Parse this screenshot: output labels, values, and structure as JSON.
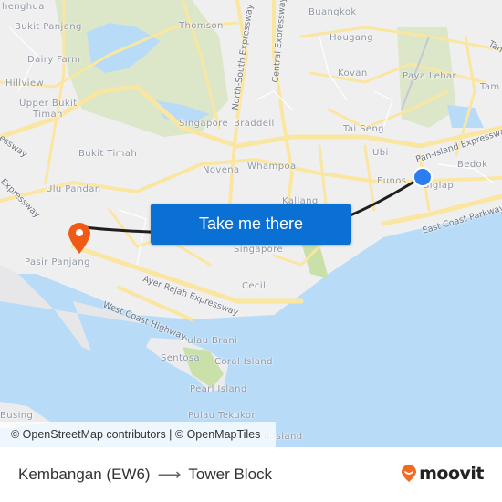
{
  "map": {
    "places": [
      {
        "name": "Chenghua",
        "text": "henghua"
      },
      {
        "name": "Bukit Panjang",
        "text": "Bukit Panjang"
      },
      {
        "name": "Dairy Farm",
        "text": "Dairy Farm"
      },
      {
        "name": "Hillview",
        "text": "Hillview"
      },
      {
        "name": "Upper Bukit Timah 1",
        "text": "Upper Bukit"
      },
      {
        "name": "Upper Bukit Timah 2",
        "text": "Timah"
      },
      {
        "name": "Thomson",
        "text": "Thomson"
      },
      {
        "name": "Buangkok",
        "text": "Buangkok"
      },
      {
        "name": "Hougang",
        "text": "Hougang"
      },
      {
        "name": "Kovan",
        "text": "Kovan"
      },
      {
        "name": "Paya Lebar",
        "text": "Paya Lebar"
      },
      {
        "name": "Tampines",
        "text": "Tam"
      },
      {
        "name": "Singapore Botanic",
        "text": "Singapore"
      },
      {
        "name": "Braddell",
        "text": "Braddell"
      },
      {
        "name": "Tai Seng",
        "text": "Tai Seng"
      },
      {
        "name": "Bukit Timah",
        "text": "Bukit Timah"
      },
      {
        "name": "Novena",
        "text": "Novena"
      },
      {
        "name": "Whampoa",
        "text": "Whampoa"
      },
      {
        "name": "Ubi",
        "text": "Ubi"
      },
      {
        "name": "Eunos",
        "text": "Eunos"
      },
      {
        "name": "Bedok",
        "text": "Bedok"
      },
      {
        "name": "Siglap",
        "text": "Siglap"
      },
      {
        "name": "Ulu Pandan",
        "text": "Ulu Pandan"
      },
      {
        "name": "Kallang",
        "text": "Kallang"
      },
      {
        "name": "Singapore",
        "text": "Singapore"
      },
      {
        "name": "Pasir Panjang",
        "text": "Pasir Panjang"
      },
      {
        "name": "Cecil",
        "text": "Cecil"
      },
      {
        "name": "Pulau Brani",
        "text": "Pulau Brani"
      },
      {
        "name": "Sentosa",
        "text": "Sentosa"
      },
      {
        "name": "Coral Island",
        "text": "Coral Island"
      },
      {
        "name": "Pearl Island",
        "text": "Pearl Island"
      },
      {
        "name": "Pulau Tekukor",
        "text": "Pulau Tekukor"
      },
      {
        "name": "Busing",
        "text": "Busing"
      },
      {
        "name": "Sisters Island",
        "text": "u Island"
      }
    ],
    "roads": [
      {
        "name": "North-South Expressway",
        "text": "North-South Expressway"
      },
      {
        "name": "Central Expressway",
        "text": "Central Expressway"
      },
      {
        "name": "Tampines Expressway",
        "text": "Tan"
      },
      {
        "name": "Pan-Island Expressway",
        "text": "Pan-Island Expressway"
      },
      {
        "name": "East Coast Parkway",
        "text": "East Coast Parkway"
      },
      {
        "name": "Ayer Rajah Expressway",
        "text": "Ayer Rajah Expressway"
      },
      {
        "name": "West Coast Highway",
        "text": "West Coast Highway"
      },
      {
        "name": "Bukit Timah Expressway",
        "text": "Expressway"
      },
      {
        "name": "Pan Island west",
        "text": "essway"
      }
    ],
    "cta_label": "Take me there",
    "attribution": "© OpenStreetMap contributors | © OpenMapTiles",
    "colors": {
      "land": "#efeff0",
      "water": "#b8dcf8",
      "park": "#dbe7c8",
      "road": "#fbe6a1",
      "route": "#1f1f1f",
      "origin": "#2c7df0",
      "destination": "#f05a14",
      "button": "#0a70d3"
    }
  },
  "footer": {
    "origin": "Kembangan (EW6)",
    "arrow": "⟶",
    "destination": "Tower Block",
    "brand": "moovit"
  }
}
